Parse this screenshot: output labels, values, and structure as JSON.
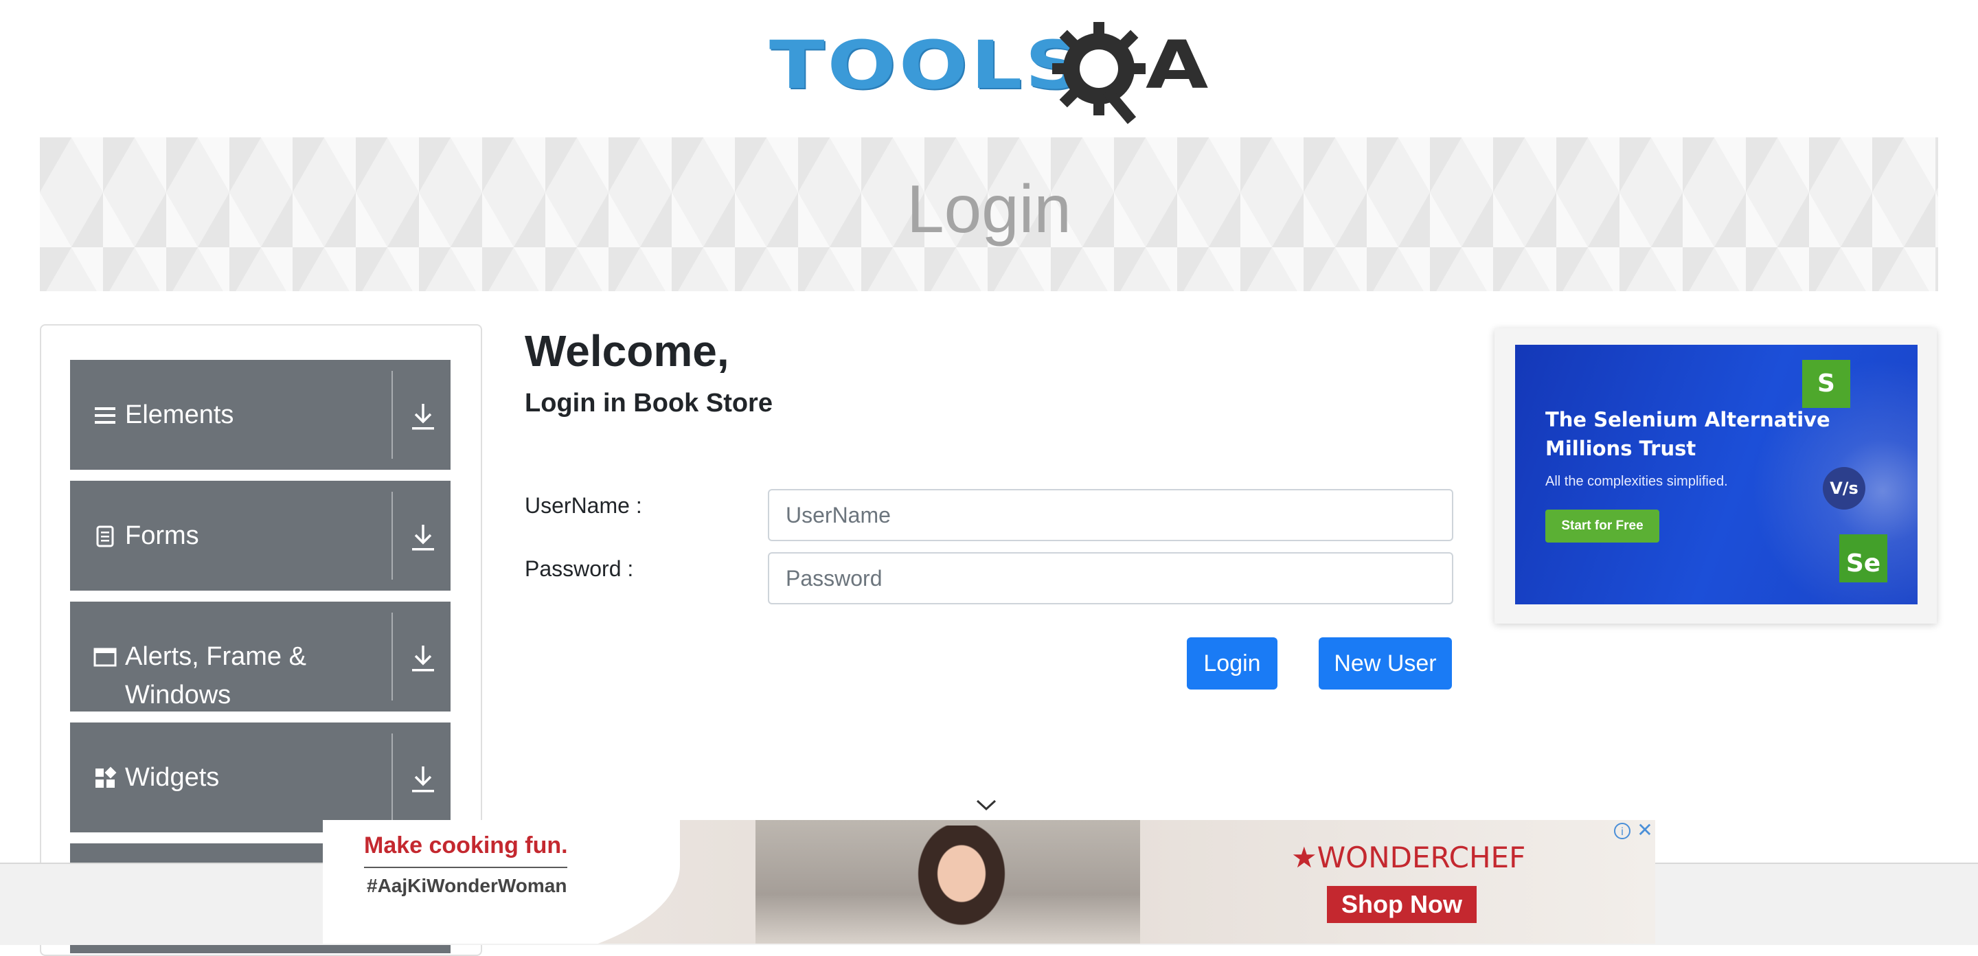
{
  "header": {
    "logo": {
      "word": "TOOLS",
      "q": "Q",
      "a": "A"
    }
  },
  "banner": {
    "title": "Login"
  },
  "nav": {
    "groups": [
      {
        "label": "Elements",
        "icon": "hamburger-icon"
      },
      {
        "label": "Forms",
        "icon": "document-icon"
      },
      {
        "label": "Alerts, Frame & Windows",
        "icon": "window-icon"
      },
      {
        "label": "Widgets",
        "icon": "widgets-icon"
      }
    ]
  },
  "main": {
    "welcome": "Welcome,",
    "subtitle": "Login in Book Store",
    "username_label": "UserName :",
    "username_placeholder": "UserName",
    "password_label": "Password :",
    "password_placeholder": "Password",
    "login_button": "Login",
    "new_user_button": "New User"
  },
  "side_ad": {
    "headline": "The Selenium Alternative Millions Trust",
    "subline": "All the complexities simplified.",
    "cta": "Start for Free",
    "tile_s": "S",
    "tile_se": "Se",
    "vs": "V/s"
  },
  "bottom_ad": {
    "tagline": "Make cooking fun.",
    "hashtag": "#AajKiWonderWoman",
    "brand": "WONDERCHEF",
    "cta": "Shop Now"
  },
  "colors": {
    "nav_group_bg": "#6c7278",
    "primary_button": "#1a7bf5",
    "logo_blue": "#3b9ad8"
  }
}
